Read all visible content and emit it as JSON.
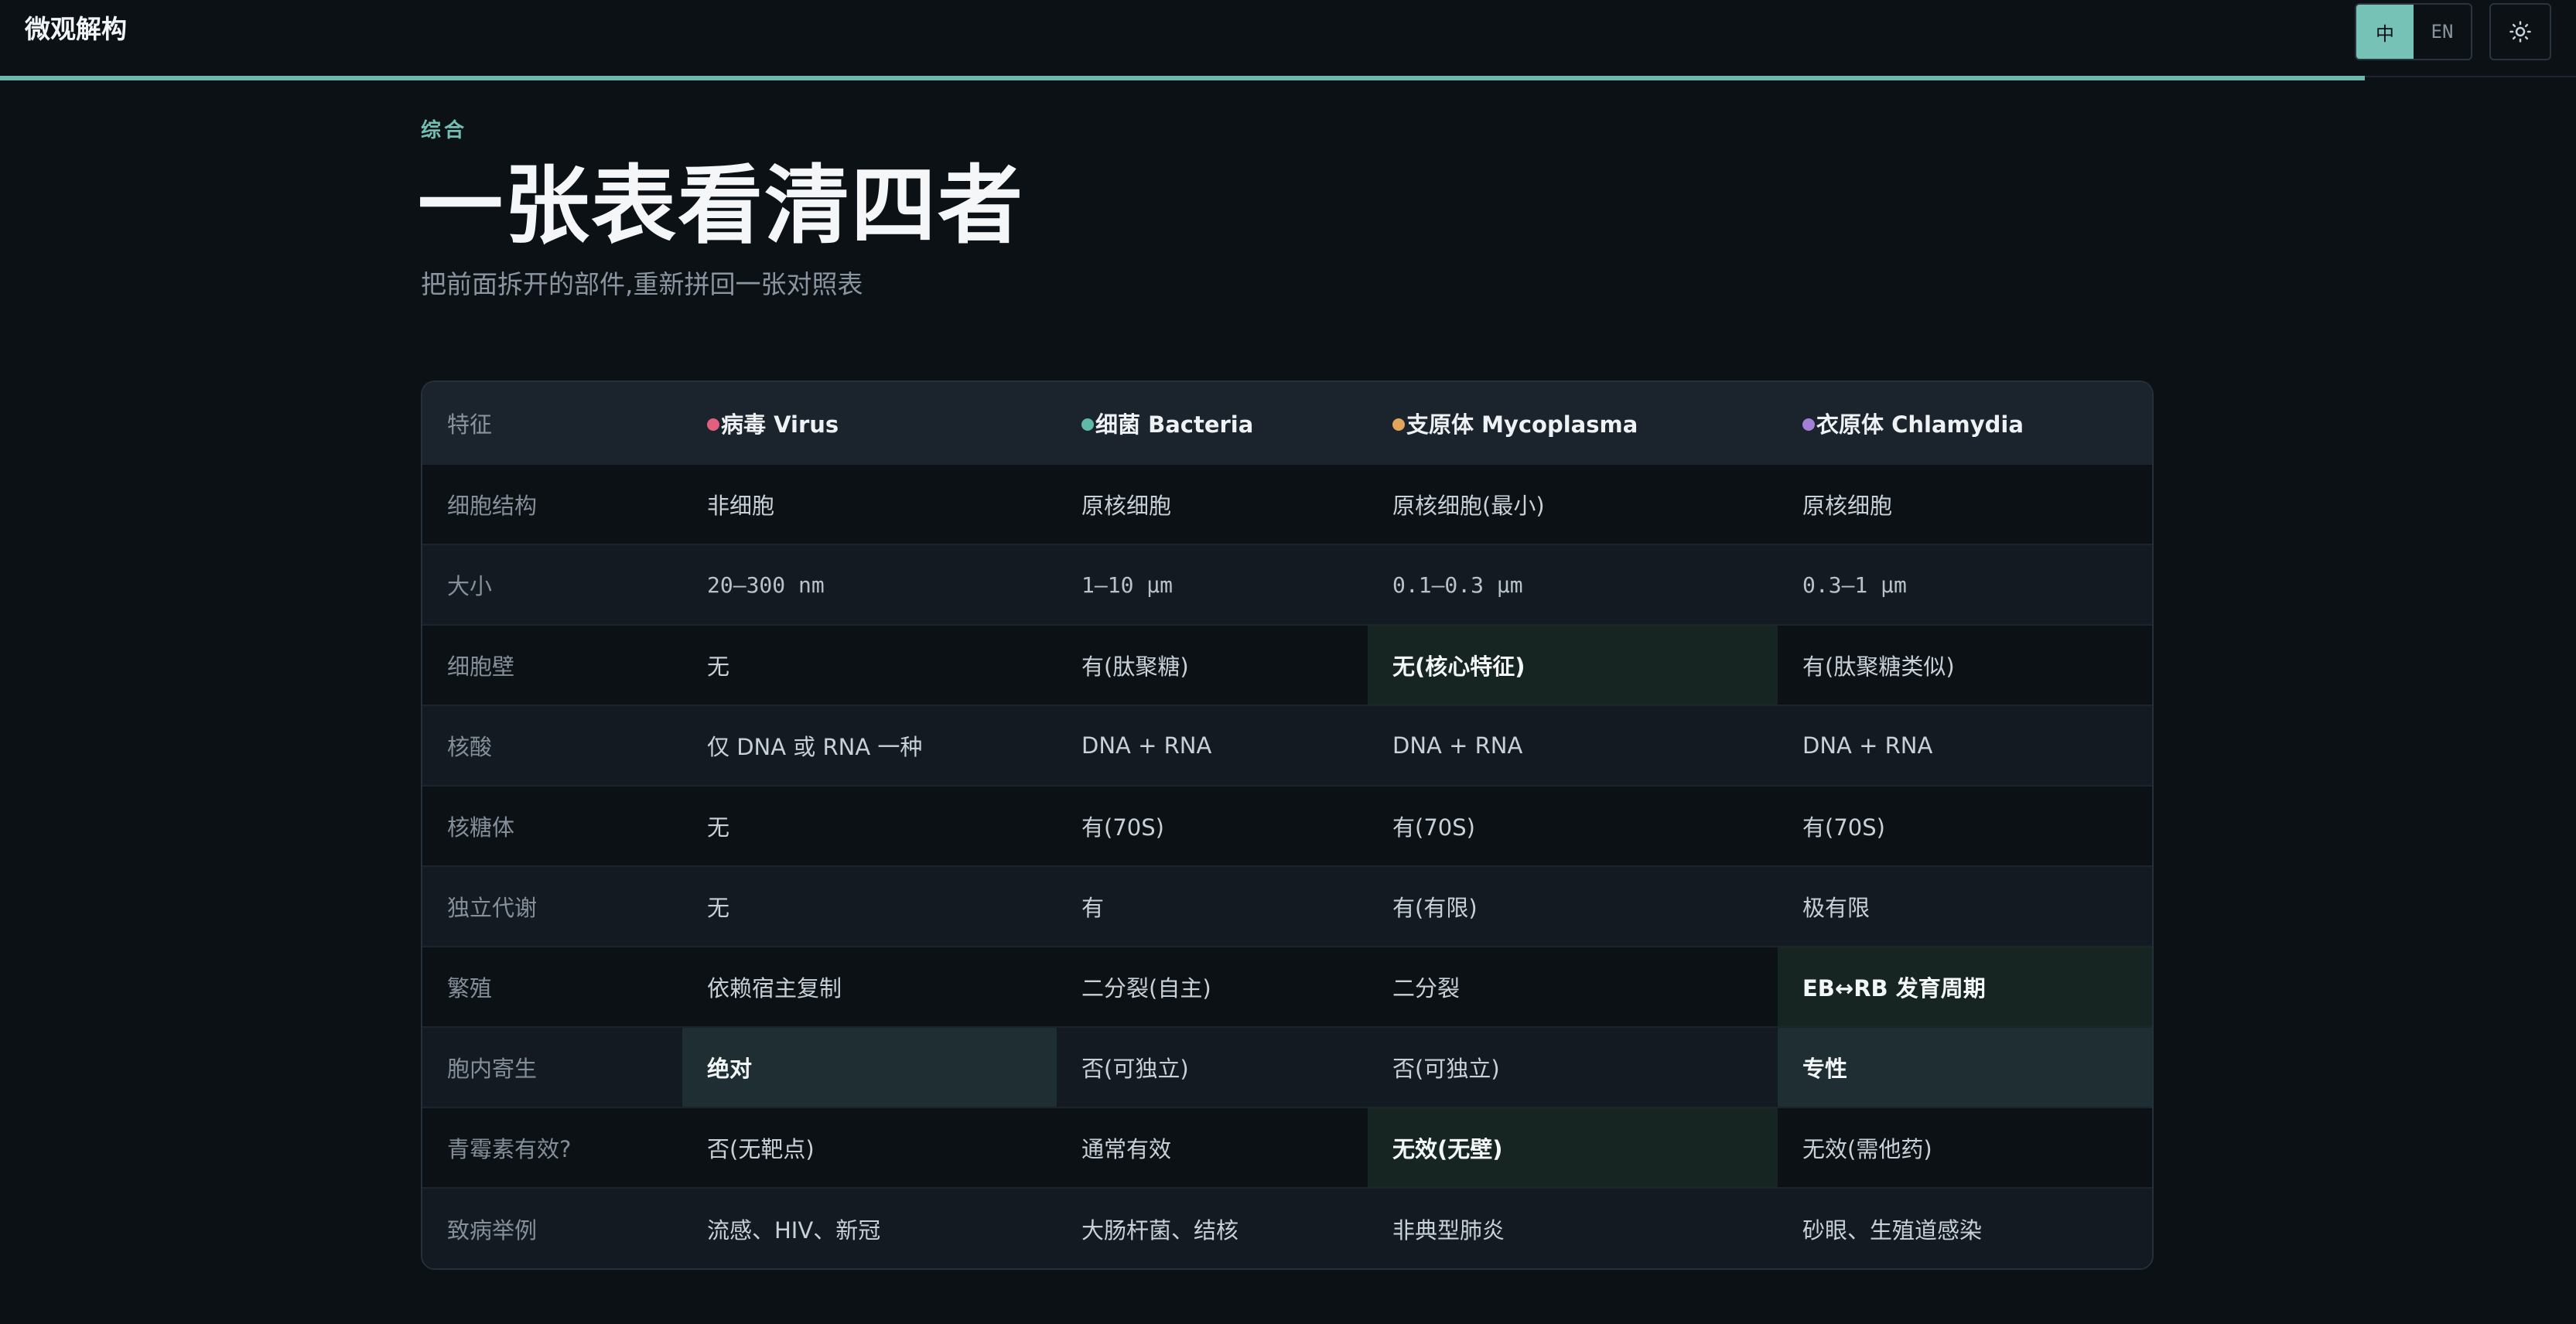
{
  "app": {
    "brand": "微观解构",
    "progress_fraction": 0.918
  },
  "toolbar": {
    "lang_zh": "中",
    "lang_en": "EN",
    "active_lang": "zh",
    "theme_icon": "sun-icon"
  },
  "header": {
    "eyebrow": "综合",
    "title": "一张表看清四者",
    "subtitle": "把前面拆开的部件,重新拼回一张对照表"
  },
  "table": {
    "feature_header": "特征",
    "columns": [
      {
        "label": "病毒 Virus",
        "dot_color": "#e0607e"
      },
      {
        "label": "细菌 Bacteria",
        "dot_color": "#5fb8a8"
      },
      {
        "label": "支原体 Mycoplasma",
        "dot_color": "#e0a55a"
      },
      {
        "label": "衣原体 Chlamydia",
        "dot_color": "#a37fd6"
      }
    ],
    "rows": [
      {
        "label": "细胞结构",
        "cells": [
          "非细胞",
          "原核细胞",
          "原核细胞(最小)",
          "原核细胞"
        ]
      },
      {
        "label": "大小",
        "cells": [
          "20–300 nm",
          "1–10 μm",
          "0.1–0.3 μm",
          "0.3–1 μm"
        ]
      },
      {
        "label": "细胞壁",
        "cells": [
          "无",
          "有(肽聚糖)",
          "无(核心特征)",
          "有(肽聚糖类似)"
        ]
      },
      {
        "label": "核酸",
        "cells": [
          "仅 DNA 或 RNA 一种",
          "DNA + RNA",
          "DNA + RNA",
          "DNA + RNA"
        ]
      },
      {
        "label": "核糖体",
        "cells": [
          "无",
          "有(70S)",
          "有(70S)",
          "有(70S)"
        ]
      },
      {
        "label": "独立代谢",
        "cells": [
          "无",
          "有",
          "有(有限)",
          "极有限"
        ]
      },
      {
        "label": "繁殖",
        "cells": [
          "依赖宿主复制",
          "二分裂(自主)",
          "二分裂",
          "EB↔RB 发育周期"
        ]
      },
      {
        "label": "胞内寄生",
        "cells": [
          "绝对",
          "否(可独立)",
          "否(可独立)",
          "专性"
        ]
      },
      {
        "label": "青霉素有效?",
        "cells": [
          "否(无靶点)",
          "通常有效",
          "无效(无壁)",
          "无效(需他药)"
        ]
      },
      {
        "label": "致病举例",
        "cells": [
          "流感、HIV、新冠",
          "大肠杆菌、结核",
          "非典型肺炎",
          "砂眼、生殖道感染"
        ]
      }
    ]
  }
}
